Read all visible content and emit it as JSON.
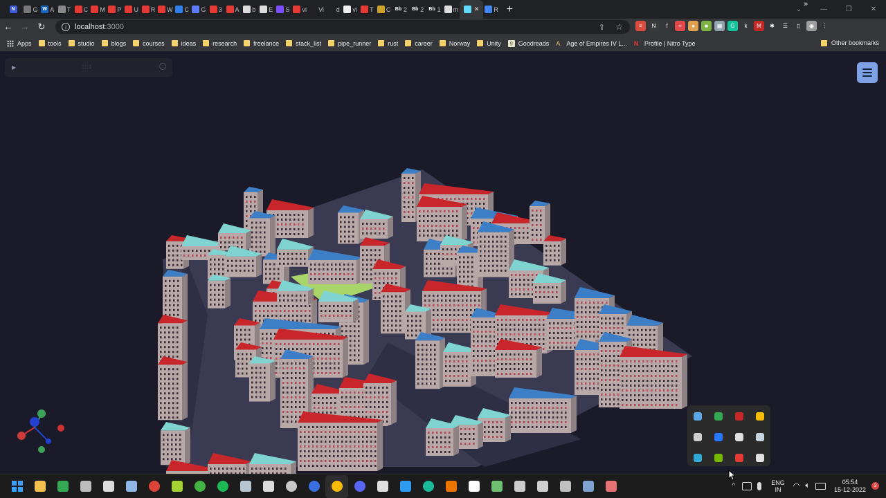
{
  "browser": {
    "tabs": [
      {
        "short": "",
        "fav": "N",
        "color": "#3b5bdb",
        "icon": "notion-icon"
      },
      {
        "short": "G",
        "fav": "",
        "color": "#777",
        "icon": "globe-icon"
      },
      {
        "short": "A",
        "fav": "W",
        "color": "#1565c0",
        "icon": "word-icon"
      },
      {
        "short": "T",
        "fav": "",
        "color": "#888",
        "icon": "unity-icon"
      },
      {
        "short": "C",
        "fav": "",
        "color": "#e53935",
        "icon": "youtube-icon"
      },
      {
        "short": "M",
        "fav": "",
        "color": "#e53935",
        "icon": "youtube-icon"
      },
      {
        "short": "P",
        "fav": "",
        "color": "#e53935",
        "icon": "youtube-icon"
      },
      {
        "short": "U",
        "fav": "",
        "color": "#e53935",
        "icon": "youtube-icon"
      },
      {
        "short": "R",
        "fav": "",
        "color": "#e53935",
        "icon": "youtube-icon"
      },
      {
        "short": "W",
        "fav": "",
        "color": "#e53935",
        "icon": "youtube-icon"
      },
      {
        "short": "C",
        "fav": "",
        "color": "#2f80ed",
        "icon": "vscode-icon"
      },
      {
        "short": "G",
        "fav": "",
        "color": "#5c7cfa",
        "icon": "hex-icon"
      },
      {
        "short": "3",
        "fav": "",
        "color": "#e53935",
        "icon": "youtube-icon"
      },
      {
        "short": "A",
        "fav": "",
        "color": "#e53935",
        "icon": "youtube-icon"
      },
      {
        "short": "b",
        "fav": "",
        "color": "#ddd",
        "icon": "github-icon"
      },
      {
        "short": "E",
        "fav": "",
        "color": "#ddd",
        "icon": "github-icon"
      },
      {
        "short": "S",
        "fav": "",
        "color": "#7c4dff",
        "icon": "vite-icon"
      },
      {
        "short": "vi",
        "fav": "",
        "color": "#e53935",
        "icon": "close-square-icon"
      },
      {
        "short": "Vi",
        "fav": "",
        "color": "#202124",
        "icon": "blank-icon"
      },
      {
        "short": "d",
        "fav": "",
        "color": "#202124",
        "icon": "blank-icon"
      },
      {
        "short": "vi",
        "fav": "",
        "color": "#eee",
        "icon": "dots-icon"
      },
      {
        "short": "T",
        "fav": "",
        "color": "#e53935",
        "icon": "youtube-icon"
      },
      {
        "short": "C",
        "fav": "",
        "color": "#c9a227",
        "icon": "note-icon"
      },
      {
        "short": "2",
        "fav": "Bb",
        "color": "#202124",
        "icon": "text-icon"
      },
      {
        "short": "2",
        "fav": "Bb",
        "color": "#202124",
        "icon": "text-icon"
      },
      {
        "short": "1",
        "fav": "Bb",
        "color": "#202124",
        "icon": "text-icon"
      },
      {
        "short": "m",
        "fav": "",
        "color": "#ddd",
        "icon": "github-icon"
      },
      {
        "short": "",
        "fav": "",
        "color": "#61dafb",
        "icon": "react-icon",
        "active": true
      },
      {
        "short": "R",
        "fav": "",
        "color": "#4285f4",
        "icon": "docs-icon"
      }
    ],
    "new_tab": "+",
    "window_controls": [
      "⌄",
      "—",
      "❐",
      "✕"
    ],
    "nav": {
      "back": "←",
      "forward": "→",
      "reload": "↻"
    },
    "url_host": "localhost",
    "url_port": ":3000",
    "share_glyph": "⇪",
    "star_glyph": "☆",
    "extensions": [
      {
        "name": "todoist-ext-icon",
        "color": "#db4c3f",
        "g": "≡"
      },
      {
        "name": "new-ext-icon",
        "color": "#3a3a3a",
        "g": "N"
      },
      {
        "name": "fx-ext-icon",
        "color": "#35363a",
        "g": "f"
      },
      {
        "name": "dash-ext-icon",
        "color": "#e0484c",
        "g": "≈"
      },
      {
        "name": "monkey-ext-icon",
        "color": "#e0a050",
        "g": "●"
      },
      {
        "name": "cube-ext-icon",
        "color": "#7cb342",
        "g": "■"
      },
      {
        "name": "grid-ext-icon",
        "color": "#90a4ae",
        "g": "▦"
      },
      {
        "name": "grammarly-ext-icon",
        "color": "#15c39a",
        "g": "G"
      },
      {
        "name": "k-ext-icon",
        "color": "#35363a",
        "g": "k"
      },
      {
        "name": "m-ext-icon",
        "color": "#c62828",
        "g": "M"
      },
      {
        "name": "puzzle-ext-icon",
        "color": "#35363a",
        "g": "✱"
      },
      {
        "name": "queue-ext-icon",
        "color": "#35363a",
        "g": "☰"
      },
      {
        "name": "sidepanel-ext-icon",
        "color": "#35363a",
        "g": "▯"
      },
      {
        "name": "profile-avatar-icon",
        "color": "#9e9e9e",
        "g": "◉"
      },
      {
        "name": "kebab-menu-icon",
        "color": "#35363a",
        "g": "⋮"
      }
    ],
    "bookmarks": [
      {
        "label": "Apps",
        "type": "apps"
      },
      {
        "label": "tools",
        "type": "folder"
      },
      {
        "label": "studio",
        "type": "folder"
      },
      {
        "label": "blogs",
        "type": "folder"
      },
      {
        "label": "courses",
        "type": "folder"
      },
      {
        "label": "ideas",
        "type": "folder"
      },
      {
        "label": "research",
        "type": "folder"
      },
      {
        "label": "freelance",
        "type": "folder"
      },
      {
        "label": "stack_list",
        "type": "folder"
      },
      {
        "label": "pipe_runner",
        "type": "folder"
      },
      {
        "label": "rust",
        "type": "folder"
      },
      {
        "label": "career",
        "type": "folder"
      },
      {
        "label": "Norway",
        "type": "folder"
      },
      {
        "label": "Unity",
        "type": "folder"
      },
      {
        "label": "Goodreads",
        "type": "goodreads"
      },
      {
        "label": "Age of Empires IV L...",
        "type": "aoe"
      },
      {
        "label": "Profile | Nitro Type",
        "type": "nitro"
      }
    ],
    "bookmarks_more": "»",
    "other_bookmarks": "Other bookmarks"
  },
  "app": {
    "leva_panel": {
      "play": "▶",
      "grip": "∷∷",
      "search": ""
    },
    "menu_button": "menu",
    "colors": {
      "background": "#1a1a28",
      "ground": "#3a3a52",
      "roof_red": "#c9262b",
      "roof_cyan": "#7fd3d1",
      "roof_blue": "#3d7fc6",
      "wall": "#b8a9a8",
      "park": "#a8d46a"
    },
    "gizmo": {
      "x_label": "X",
      "y_label": "Y",
      "z_label": "Z"
    }
  },
  "tray_popup": {
    "icons": [
      {
        "name": "onedrive-icon",
        "color": "#5aa9e6"
      },
      {
        "name": "drive-icon",
        "color": "#34a853"
      },
      {
        "name": "mcafee-icon",
        "color": "#c62828"
      },
      {
        "name": "chrome-icon",
        "color": "#fbbc05"
      },
      {
        "name": "epic-games-icon",
        "color": "#cfcfcf"
      },
      {
        "name": "bluetooth-icon",
        "color": "#2979ff"
      },
      {
        "name": "gpu-icon",
        "color": "#e0e0e0"
      },
      {
        "name": "steam-icon",
        "color": "#c7d5e0"
      },
      {
        "name": "edge-icon",
        "color": "#31a8d6"
      },
      {
        "name": "nvidia-icon",
        "color": "#76b900"
      },
      {
        "name": "reverse-icon",
        "color": "#e53935"
      },
      {
        "name": "discord-icon",
        "color": "#e0e0e0"
      }
    ]
  },
  "taskbar": {
    "apps": [
      {
        "name": "windows-start-icon",
        "color": "#3aa0ff"
      },
      {
        "name": "file-explorer-icon",
        "color": "#f2c14e"
      },
      {
        "name": "drive-app-icon",
        "color": "#34a853"
      },
      {
        "name": "unity-hub-icon",
        "color": "#bdbdbd"
      },
      {
        "name": "calculator-icon",
        "color": "#dcdcdc"
      },
      {
        "name": "photos-icon",
        "color": "#8fb8e8"
      },
      {
        "name": "chrome-app-icon",
        "color": "#db4437"
      },
      {
        "name": "cube-app-icon",
        "color": "#a4d233"
      },
      {
        "name": "xbox-icon",
        "color": "#43b343"
      },
      {
        "name": "spotify-icon",
        "color": "#1db954"
      },
      {
        "name": "steam-app-icon",
        "color": "#b8c6d2"
      },
      {
        "name": "epic-app-icon",
        "color": "#dddddd"
      },
      {
        "name": "obs-icon",
        "color": "#c8c8c8"
      },
      {
        "name": "bluetooth-app-icon",
        "color": "#3b6fe0"
      },
      {
        "name": "chrome-active-icon",
        "color": "#fbbc05"
      },
      {
        "name": "discord-app-icon",
        "color": "#5865f2"
      },
      {
        "name": "unreal-icon",
        "color": "#e0e0e0"
      },
      {
        "name": "vscode-app-icon",
        "color": "#2f9bf0"
      },
      {
        "name": "gitkraken-icon",
        "color": "#1abc9c"
      },
      {
        "name": "blender-icon",
        "color": "#ea7600"
      },
      {
        "name": "notion-app-icon",
        "color": "#ffffff"
      },
      {
        "name": "terminal-icon",
        "color": "#6fbf73"
      },
      {
        "name": "davinci-icon",
        "color": "#cccccc"
      },
      {
        "name": "unity-app-icon",
        "color": "#d0d0d0"
      },
      {
        "name": "github-desktop-icon",
        "color": "#c0c0c0"
      },
      {
        "name": "photo-editor-icon",
        "color": "#7ea3d1"
      },
      {
        "name": "snip-tool-icon",
        "color": "#e57373"
      }
    ],
    "lang_1": "ENG",
    "lang_2": "IN",
    "time": "05:54",
    "date": "15-12-2022",
    "notifications": "3",
    "tray_arrow": "^"
  }
}
